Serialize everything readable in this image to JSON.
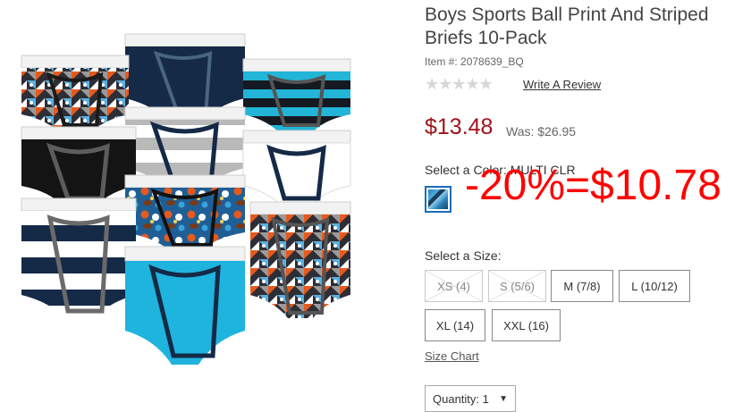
{
  "product": {
    "title": "Boys Sports Ball Print And Striped Briefs 10-Pack",
    "item_number": "Item #: 2078639_BQ",
    "stars": "★★★★★",
    "write_review": "Write A Review",
    "price": "$13.48",
    "was_price": "Was: $26.95"
  },
  "color": {
    "label": "Select a Color: MULTI CLR",
    "swatch_name": "multi-clr-swatch"
  },
  "overlay": {
    "discount_text": "-20%=$10.78",
    "color": "#ff0000"
  },
  "sizes": {
    "label": "Select a Size:",
    "options": [
      {
        "label": "XS (4)",
        "available": false
      },
      {
        "label": "S (5/6)",
        "available": false
      },
      {
        "label": "M (7/8)",
        "available": true
      },
      {
        "label": "L (10/12)",
        "available": true
      },
      {
        "label": "XL (14)",
        "available": true
      },
      {
        "label": "XXL (16)",
        "available": true
      }
    ],
    "size_chart": "Size Chart"
  },
  "quantity": {
    "label": "Quantity: 1",
    "arrow": "▼"
  },
  "colors": {
    "price_red": "#a0121a",
    "selected_border": "#1c6bbd"
  }
}
